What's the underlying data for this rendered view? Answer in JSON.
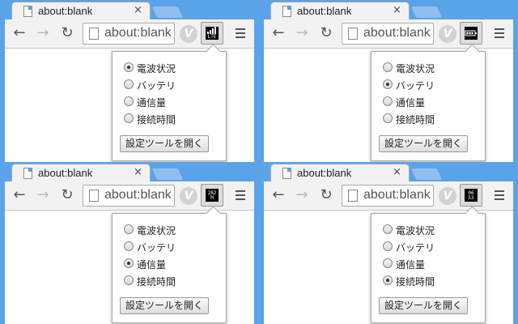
{
  "tab": {
    "title": "about:blank",
    "close_glyph": "×"
  },
  "toolbar": {
    "omnibox_text": "about:blank",
    "extension_badge": "V"
  },
  "popup": {
    "options": [
      "電波状況",
      "バッテリ",
      "通信量",
      "接続時間"
    ],
    "settings_button": "設定ツールを開く"
  },
  "panes": [
    {
      "selected_option": 0,
      "icon": {
        "kind": "signal-lte-icon",
        "text": "LTE"
      }
    },
    {
      "selected_option": 1,
      "icon": {
        "kind": "battery-icon",
        "text": ""
      }
    },
    {
      "selected_option": 2,
      "icon": {
        "kind": "data-usage-icon",
        "text": "282 M"
      }
    },
    {
      "selected_option": 3,
      "icon": {
        "kind": "connection-time-icon",
        "text": "06 53"
      }
    }
  ],
  "colors": {
    "desktop": "#5aa3e8",
    "chrome": "#f2f2f2",
    "content": "#ffffff"
  }
}
